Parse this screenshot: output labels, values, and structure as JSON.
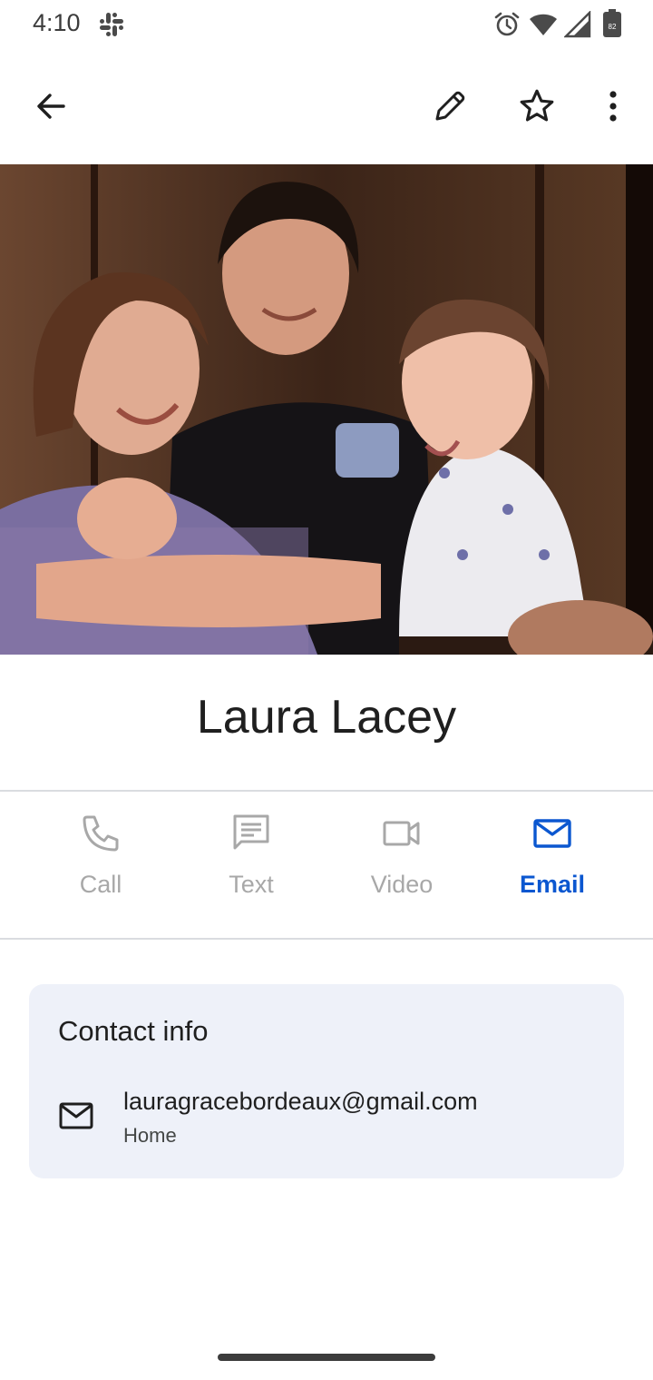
{
  "status_bar": {
    "time": "4:10",
    "icons": [
      "slack-icon",
      "alarm-icon",
      "wifi-icon",
      "signal-icon",
      "battery-icon"
    ],
    "battery_level": "82"
  },
  "app_bar": {
    "icons": [
      "back-arrow-icon",
      "pencil-icon",
      "star-outline-icon",
      "more-vertical-icon"
    ]
  },
  "contact": {
    "name": "Laura Lacey",
    "photo_description": "photo-of-family"
  },
  "actions": [
    {
      "label": "Call",
      "icon": "phone-icon",
      "color": "#a8a8a8"
    },
    {
      "label": "Text",
      "icon": "message-icon",
      "color": "#a8a8a8"
    },
    {
      "label": "Video",
      "icon": "video-camera-icon",
      "color": "#a8a8a8"
    },
    {
      "label": "Email",
      "icon": "email-icon",
      "color": "#0b57d0"
    }
  ],
  "contact_info": {
    "title": "Contact info",
    "email": {
      "icon": "mail-icon",
      "value": "lauragracebordeaux@gmail.com",
      "type": "Home"
    }
  },
  "colors": {
    "accent": "#0b57d0",
    "disabled": "#a8a8a8",
    "card_bg": "#eef1f9",
    "divider": "#dadce0"
  }
}
